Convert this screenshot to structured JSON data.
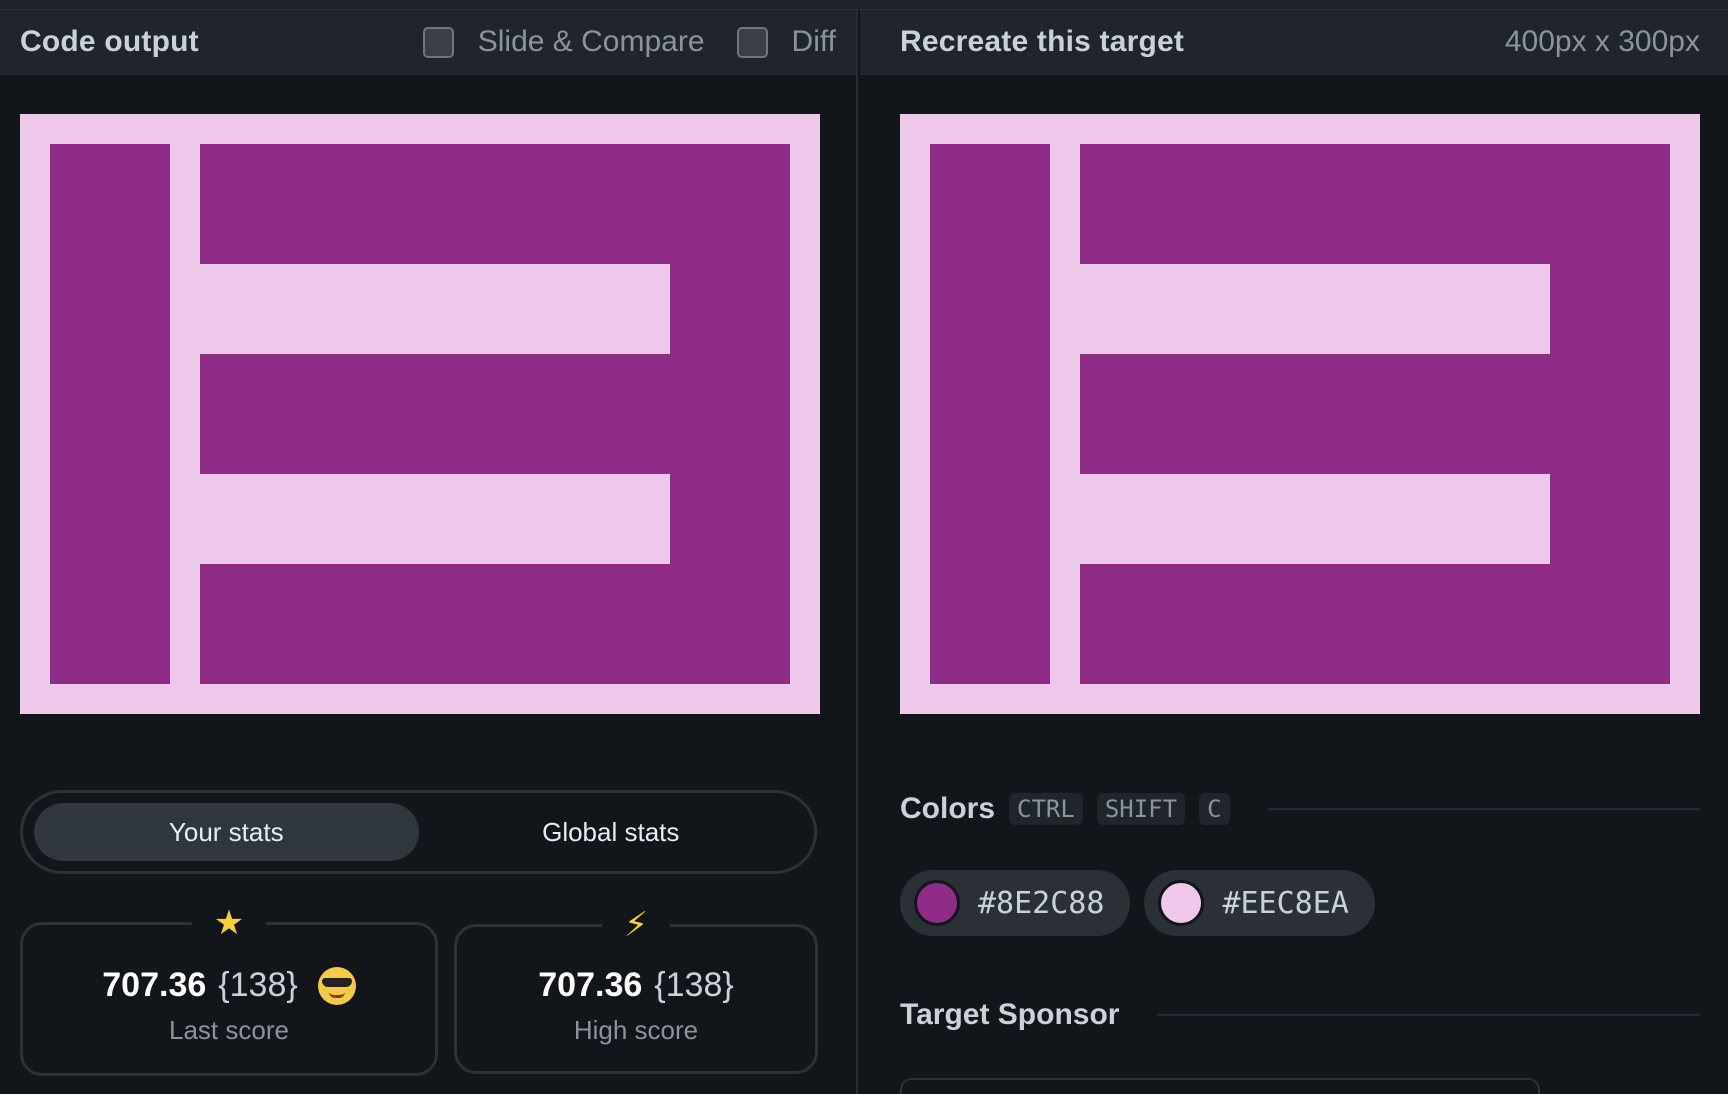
{
  "left_panel": {
    "title": "Code output",
    "slide_compare_label": "Slide & Compare",
    "diff_label": "Diff"
  },
  "right_panel": {
    "title": "Recreate this target",
    "size_label": "400px x 300px"
  },
  "stats_tabs": {
    "your_stats": "Your stats",
    "global_stats": "Global stats",
    "active": "your_stats"
  },
  "last_score": {
    "icon": "star-icon",
    "score": "707.36",
    "count": "{138}",
    "emoji": "sunglasses-emoji",
    "label": "Last score"
  },
  "high_score": {
    "icon": "lightning-icon",
    "score": "707.36",
    "count": "{138}",
    "label": "High score"
  },
  "colors_section": {
    "title": "Colors",
    "shortcut": [
      "CTRL",
      "SHIFT",
      "C"
    ],
    "swatches": [
      {
        "hex": "#8E2C88",
        "color": "#8E2C88"
      },
      {
        "hex": "#EEC8EA",
        "color": "#EEC8EA"
      }
    ]
  },
  "sponsor_section": {
    "title": "Target Sponsor"
  },
  "icons": {
    "star": "★",
    "bolt": "⚡"
  }
}
